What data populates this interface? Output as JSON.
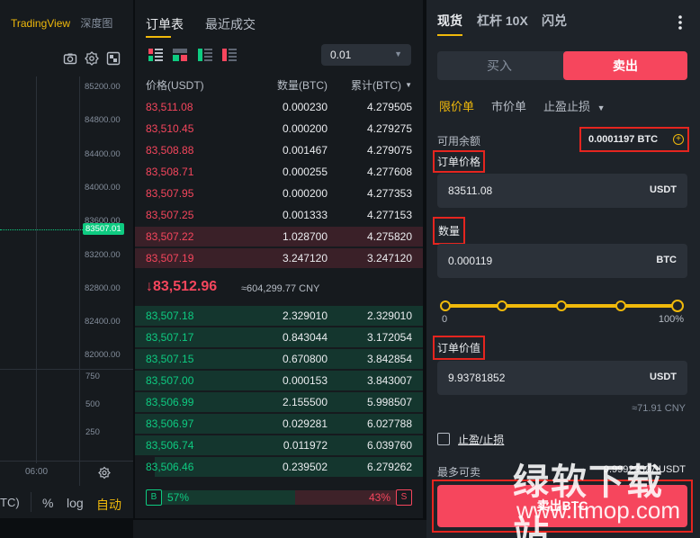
{
  "chart": {
    "tabs": [
      "TradingView",
      "深度图"
    ],
    "tool_icons": [
      "camera-icon",
      "settings-icon",
      "fullscreen-icon"
    ],
    "price_ticks": [
      "85200.00",
      "84800.00",
      "84400.00",
      "84000.00",
      "83600.00",
      "83200.00",
      "82800.00",
      "82400.00",
      "82000.00"
    ],
    "current_price_tag": "83507.01",
    "volume_ticks": [
      "750",
      "500",
      "250"
    ],
    "time_label": "06:00",
    "bottom": {
      "pct": "%",
      "log": "log",
      "auto": "自动",
      "left_cut": "TC)"
    }
  },
  "book": {
    "tabs": [
      "订单表",
      "最近成交"
    ],
    "precision": "0.01",
    "headers": {
      "price": "价格(USDT)",
      "qty": "数量(BTC)",
      "total": "累计(BTC)"
    },
    "asks": [
      {
        "price": "83,511.08",
        "qty": "0.000230",
        "total": "4.279505",
        "depth": 0.0
      },
      {
        "price": "83,510.45",
        "qty": "0.000200",
        "total": "4.279275",
        "depth": 0.0
      },
      {
        "price": "83,508.88",
        "qty": "0.001467",
        "total": "4.279075",
        "depth": 0.0
      },
      {
        "price": "83,508.71",
        "qty": "0.000255",
        "total": "4.277608",
        "depth": 0.0
      },
      {
        "price": "83,507.95",
        "qty": "0.000200",
        "total": "4.277353",
        "depth": 0.0
      },
      {
        "price": "83,507.25",
        "qty": "0.001333",
        "total": "4.277153",
        "depth": 0.0
      },
      {
        "price": "83,507.22",
        "qty": "1.028700",
        "total": "4.275820",
        "depth": 1.0
      },
      {
        "price": "83,507.19",
        "qty": "3.247120",
        "total": "3.247120",
        "depth": 1.0
      }
    ],
    "mid": {
      "price": "83,512.96",
      "cny": "≈604,299.77 CNY"
    },
    "bids": [
      {
        "price": "83,507.18",
        "qty": "2.329010",
        "total": "2.329010",
        "depth": 1.0
      },
      {
        "price": "83,507.17",
        "qty": "0.843044",
        "total": "3.172054",
        "depth": 1.0
      },
      {
        "price": "83,507.15",
        "qty": "0.670800",
        "total": "3.842854",
        "depth": 1.0
      },
      {
        "price": "83,507.00",
        "qty": "0.000153",
        "total": "3.843007",
        "depth": 1.0
      },
      {
        "price": "83,506.99",
        "qty": "2.155500",
        "total": "5.998507",
        "depth": 1.0
      },
      {
        "price": "83,506.97",
        "qty": "0.029281",
        "total": "6.027788",
        "depth": 1.0
      },
      {
        "price": "83,506.74",
        "qty": "0.011972",
        "total": "6.039760",
        "depth": 1.0
      },
      {
        "price": "83,506.46",
        "qty": "0.239502",
        "total": "6.279262",
        "depth": 0.93
      }
    ],
    "ratio": {
      "buy_label": "B",
      "buy_pct": "57%",
      "sell_label": "S",
      "sell_pct": "43%",
      "buy_share": 0.57
    }
  },
  "trade": {
    "tabs": [
      "现货",
      "杠杆 10X",
      "闪兑"
    ],
    "buy_label": "买入",
    "sell_label": "卖出",
    "order_types": [
      "限价单",
      "市价单",
      "止盈止损"
    ],
    "available_label": "可用余额",
    "available_value": "0.0001197 BTC",
    "price_label": "订单价格",
    "price_value": "83511.08",
    "price_unit": "USDT",
    "qty_label": "数量",
    "qty_value": "0.000119",
    "qty_unit": "BTC",
    "slider_min": "0",
    "slider_max": "100%",
    "slider_value": 1.0,
    "total_label": "订单价值",
    "total_value": "9.93781852",
    "total_unit": "USDT",
    "total_cny": "≈71.91 CNY",
    "tpsl_label": "止盈/止损",
    "max_label": "最多可卖",
    "max_value": "9.99922527 USDT",
    "submit_label": "卖出BTC"
  },
  "watermark": {
    "cn": "绿软下载站",
    "url": "www.itmop.com"
  },
  "colors": {
    "sell": "#f6465d",
    "buy": "#0ecb81",
    "accent": "#f0b90b",
    "highlight_box": "#e5251f"
  }
}
